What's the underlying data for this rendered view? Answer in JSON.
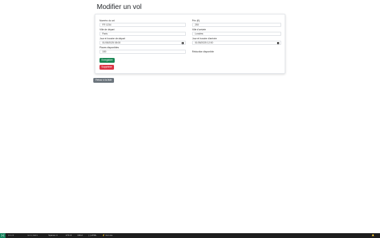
{
  "page": {
    "title": "Modifier un vol"
  },
  "form": {
    "flight_number": {
      "label": "Numéro du vol",
      "value": "FR 1234"
    },
    "price": {
      "label": "Prix (€)",
      "value": "250"
    },
    "departure_city": {
      "label": "Ville de départ",
      "value": "Paris"
    },
    "arrival_city": {
      "label": "Ville d'arrivée",
      "value": "Londres"
    },
    "departure_datetime": {
      "label": "Jour et horaire de départ",
      "value": "01/05/2025 08:00"
    },
    "arrival_datetime": {
      "label": "Jour et horaire d'arrivée",
      "value": "01/05/2025 12:00"
    },
    "seats": {
      "label": "Places disponibles",
      "value": "150"
    },
    "reduction": {
      "label": "Réduction disponible"
    },
    "save_label": "Enregistrer",
    "delete_label": "Supprimer"
  },
  "back_label": "Retour à la liste",
  "statusbar": {
    "items": [
      "0 ⚠ 0",
      "Ln 1, Col 1",
      "Spaces: 4",
      "UTF-8",
      "CRLF",
      "{ } HTML",
      "⚡ Go Live",
      "🔔"
    ],
    "accent_color": "#16825d"
  }
}
